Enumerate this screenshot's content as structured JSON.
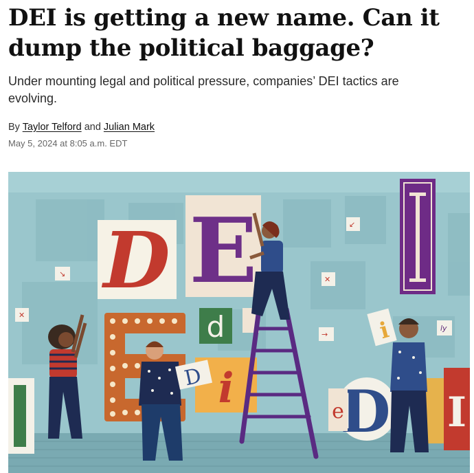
{
  "article": {
    "headline": "DEI is getting a new name. Can it dump the political baggage?",
    "dek": "Under mounting legal and political pressure, companies’ DEI tactics are evolving.",
    "byline": {
      "prefix": "By ",
      "author1": "Taylor Telford",
      "joiner": " and ",
      "author2": "Julian Mark"
    },
    "timestamp": "May 5, 2024 at 8:05 a.m. EDT"
  },
  "illustration": {
    "letters": [
      "D",
      "E",
      "I",
      "E",
      "d",
      "i",
      "D",
      "I",
      "e",
      "i"
    ]
  },
  "colors": {
    "wall": "#9ac6cc",
    "purple": "#5e2a78",
    "red": "#c23a2e",
    "orange": "#c8682e",
    "green": "#3e7d4a",
    "navy": "#1e2b52"
  }
}
